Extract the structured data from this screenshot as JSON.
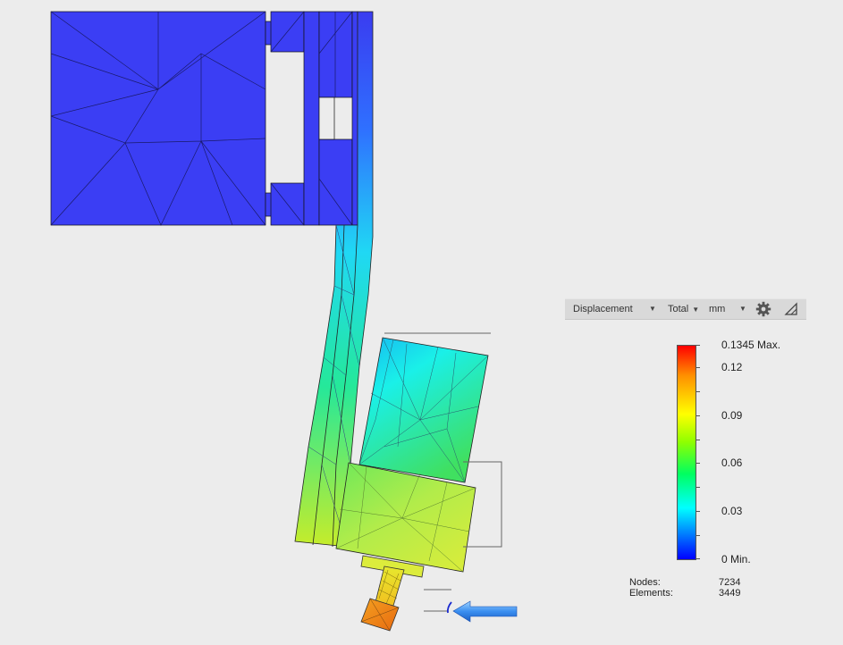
{
  "toolbar": {
    "result_type": "Displacement",
    "component": "Total",
    "unit": "mm",
    "settings_icon": "gear-icon",
    "collapse_icon": "triangle-corner-icon"
  },
  "legend": {
    "max_label": "0.1345 Max.",
    "labels": [
      "0.12",
      "0.09",
      "0.06",
      "0.03"
    ],
    "min_label": "0 Min.",
    "colors": {
      "min": "#0000ff",
      "low": "#00ffff",
      "mid": "#00ff60",
      "high": "#ffff00",
      "max": "#ff0000"
    }
  },
  "stats": {
    "nodes_label": "Nodes:",
    "nodes_value": "7234",
    "elements_label": "Elements:",
    "elements_value": "3449"
  },
  "scene": {
    "load_arrow_icon": "force-arrow-icon",
    "constraint_icon": "displacement-marker-icon"
  }
}
